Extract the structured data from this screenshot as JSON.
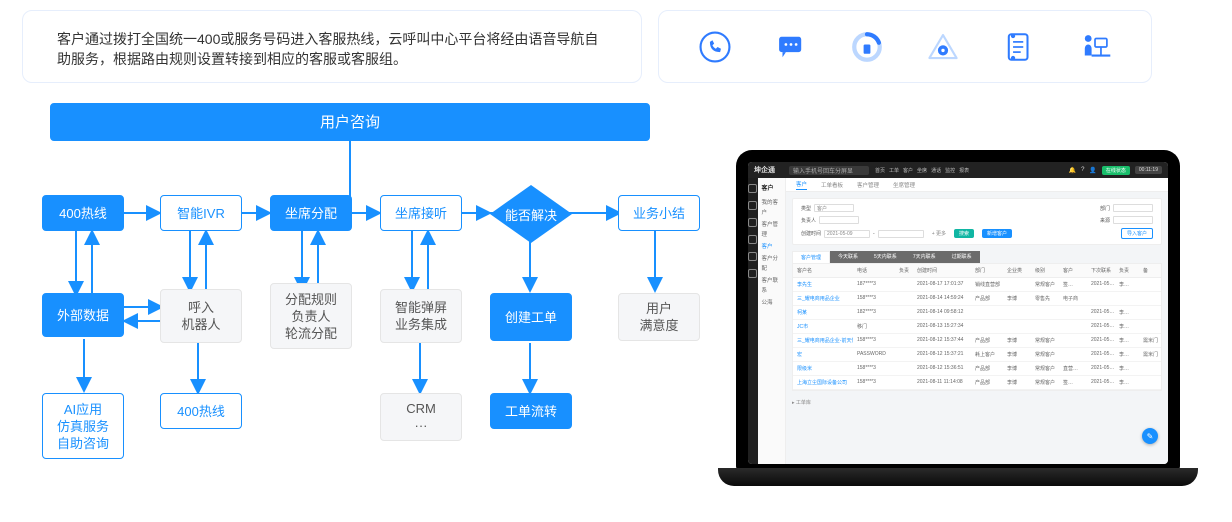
{
  "description": "客户通过拨打全国统一400或服务号码进入客服热线，云呼叫中心平台将经由语音导航自助服务，根据路由规则设置转接到相应的客服或客服组。",
  "top_icons": [
    {
      "name": "phone-icon"
    },
    {
      "name": "message-icon"
    },
    {
      "name": "gauge-icon"
    },
    {
      "name": "eye-triangle-icon"
    },
    {
      "name": "clipboard-icon"
    },
    {
      "name": "workstation-icon"
    }
  ],
  "flow": {
    "title": "用户咨询",
    "row_main": {
      "hotline": "400热线",
      "ivr": "智能IVR",
      "seat_assign": "坐席分配",
      "seat_answer": "坐席接听",
      "decision": "能否解决",
      "summary": "业务小结"
    },
    "row_sub": {
      "ext_data": "外部数据",
      "inbound_bot": "呼入\n机器人",
      "alloc_rules": "分配规则\n负责人\n轮流分配",
      "popup_integration": "智能弹屏\n业务集成",
      "create_ticket": "创建工单",
      "user_satisfaction": "用户\n满意度"
    },
    "row_bottom": {
      "ai_self_service": "AI应用\n仿真服务\n自助咨询",
      "hotline_b": "400热线",
      "crm": "CRM\n···",
      "ticket_flow": "工单流转"
    }
  },
  "laptop": {
    "brand": "坤企通",
    "search_placeholder": "输入手机号回车分屏显",
    "topbar_items": [
      "首页",
      "工单",
      "客户",
      "坐席",
      "通话",
      "监控",
      "报表"
    ],
    "status_online": "在线状态",
    "status_time": "00:11:19",
    "nav_title": "客户",
    "nav_items": [
      "我的客户",
      "客户管理",
      "客户",
      "客户分配",
      "客户联系",
      "公海"
    ],
    "main_tabs": [
      "客户",
      "工单看板",
      "客户管理",
      "坐席管理"
    ],
    "filters": {
      "label_type": "类型",
      "value_type": "客户",
      "label_dept": "部门",
      "label_owner": "负责人",
      "label_source": "来源",
      "label_ctime": "创建时间",
      "date_from": "2021-05-09",
      "btn_more": "+ 更多",
      "btn_search": "搜索",
      "btn_add": "新增客户",
      "btn_import": "导入客户"
    },
    "subtabs": [
      "客户管理",
      "今天联系",
      "5天内联系",
      "7天内联系",
      "过期联系"
    ],
    "table": {
      "headers": [
        "客户名",
        "电话",
        "负责",
        "创建时间",
        "部门",
        "企业类",
        "级别",
        "客户",
        "下次联系",
        "负责",
        "备"
      ],
      "rows": [
        [
          "李先生",
          "187****3",
          "",
          "2021-08-17 17:01:37",
          "销线直营部",
          "",
          "常规客户",
          "签…",
          "2021-05…",
          "李…",
          ""
        ],
        [
          "三_耀电商用品企业",
          "158****3",
          "",
          "2021-08-14 14:59:24",
          "产品部",
          "李博",
          "零售先",
          "电子商",
          "",
          "",
          ""
        ],
        [
          "柯某",
          "182****3",
          "",
          "2021-08-14 09:58:12",
          "",
          "",
          "",
          "",
          "2021-05…",
          "李…",
          ""
        ],
        [
          "JC市",
          "移门",
          "",
          "2021-08-13 15:27:34",
          "",
          "",
          "",
          "",
          "2021-05…",
          "李…",
          ""
        ],
        [
          "三_耀电商用品企业-前天性",
          "158****3",
          "",
          "2021-08-12 15:37:44",
          "产品部",
          "李博",
          "常规客户",
          "",
          "2021-05…",
          "李…",
          "需米门"
        ],
        [
          "宏",
          "PASSWORD",
          "",
          "2021-08-12 15:37:21",
          "耗上客户",
          "李博",
          "常规客户",
          "",
          "2021-05…",
          "李…",
          "需米门"
        ],
        [
          "限级米",
          "158****3",
          "",
          "2021-08-12 15:36:51",
          "产品部",
          "李博",
          "常规客户",
          "直营…",
          "2021-05…",
          "李…",
          ""
        ],
        [
          "上海立尘国际设备公司",
          "158****3",
          "",
          "2021-08-11 11:14:08",
          "产品部",
          "李博",
          "常规客户",
          "签…",
          "2021-05…",
          "李…",
          ""
        ]
      ]
    },
    "footer_label": "工单库",
    "fab": "✎"
  }
}
